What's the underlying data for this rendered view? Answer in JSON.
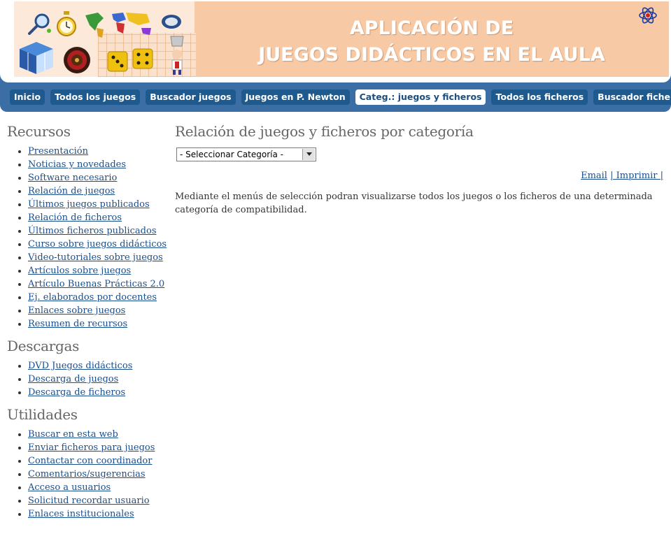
{
  "banner": {
    "title_line1": "APLICACIÓN DE",
    "title_line2": "JUEGOS DIDÁCTICOS EN EL AULA"
  },
  "nav": {
    "items": [
      {
        "label": "Inicio"
      },
      {
        "label": "Todos los juegos"
      },
      {
        "label": "Buscador juegos"
      },
      {
        "label": "Juegos en P. Newton"
      },
      {
        "label": "Categ.: juegos y ficheros"
      },
      {
        "label": "Todos los ficheros"
      },
      {
        "label": "Buscador ficheros"
      }
    ],
    "active_index": 4
  },
  "sidebar": {
    "recursos": {
      "heading": "Recursos",
      "items": [
        "Presentación",
        "Noticias y novedades",
        "Software necesario",
        "Relación de juegos",
        "Últimos juegos publicados",
        "Relación de ficheros",
        "Últimos ficheros publicados",
        "Curso sobre juegos didácticos",
        "Video-tutoriales sobre juegos",
        "Artículos sobre juegos",
        "Artículo Buenas Prácticas 2.0",
        "Ej. elaborados por docentes",
        "Enlaces sobre juegos",
        "Resumen de recursos"
      ]
    },
    "descargas": {
      "heading": "Descargas",
      "items": [
        "DVD Juegos didácticos",
        "Descarga de juegos",
        "Descarga de ficheros"
      ]
    },
    "utilidades": {
      "heading": "Utilidades",
      "items": [
        "Buscar en esta web",
        "Enviar ficheros para juegos",
        "Contactar con coordinador",
        "Comentarios/sugerencias",
        "Acceso a usuarios",
        "Solicitud recordar usuario",
        "Enlaces institucionales"
      ]
    }
  },
  "main": {
    "title": "Relación de juegos y ficheros por categoría",
    "select_value": "- Seleccionar Categoría -",
    "email_label": "Email",
    "print_label": "| Imprimir |",
    "description": "Mediante el menús de selección podran visualizarse todos los juegos o los ficheros de una determinada categoría de compatibilidad."
  },
  "colors": {
    "nav_bar": "#3a6ea5",
    "nav_button": "#1e5a8e",
    "banner": "#f7c9a4",
    "link": "#1a4e8c"
  }
}
